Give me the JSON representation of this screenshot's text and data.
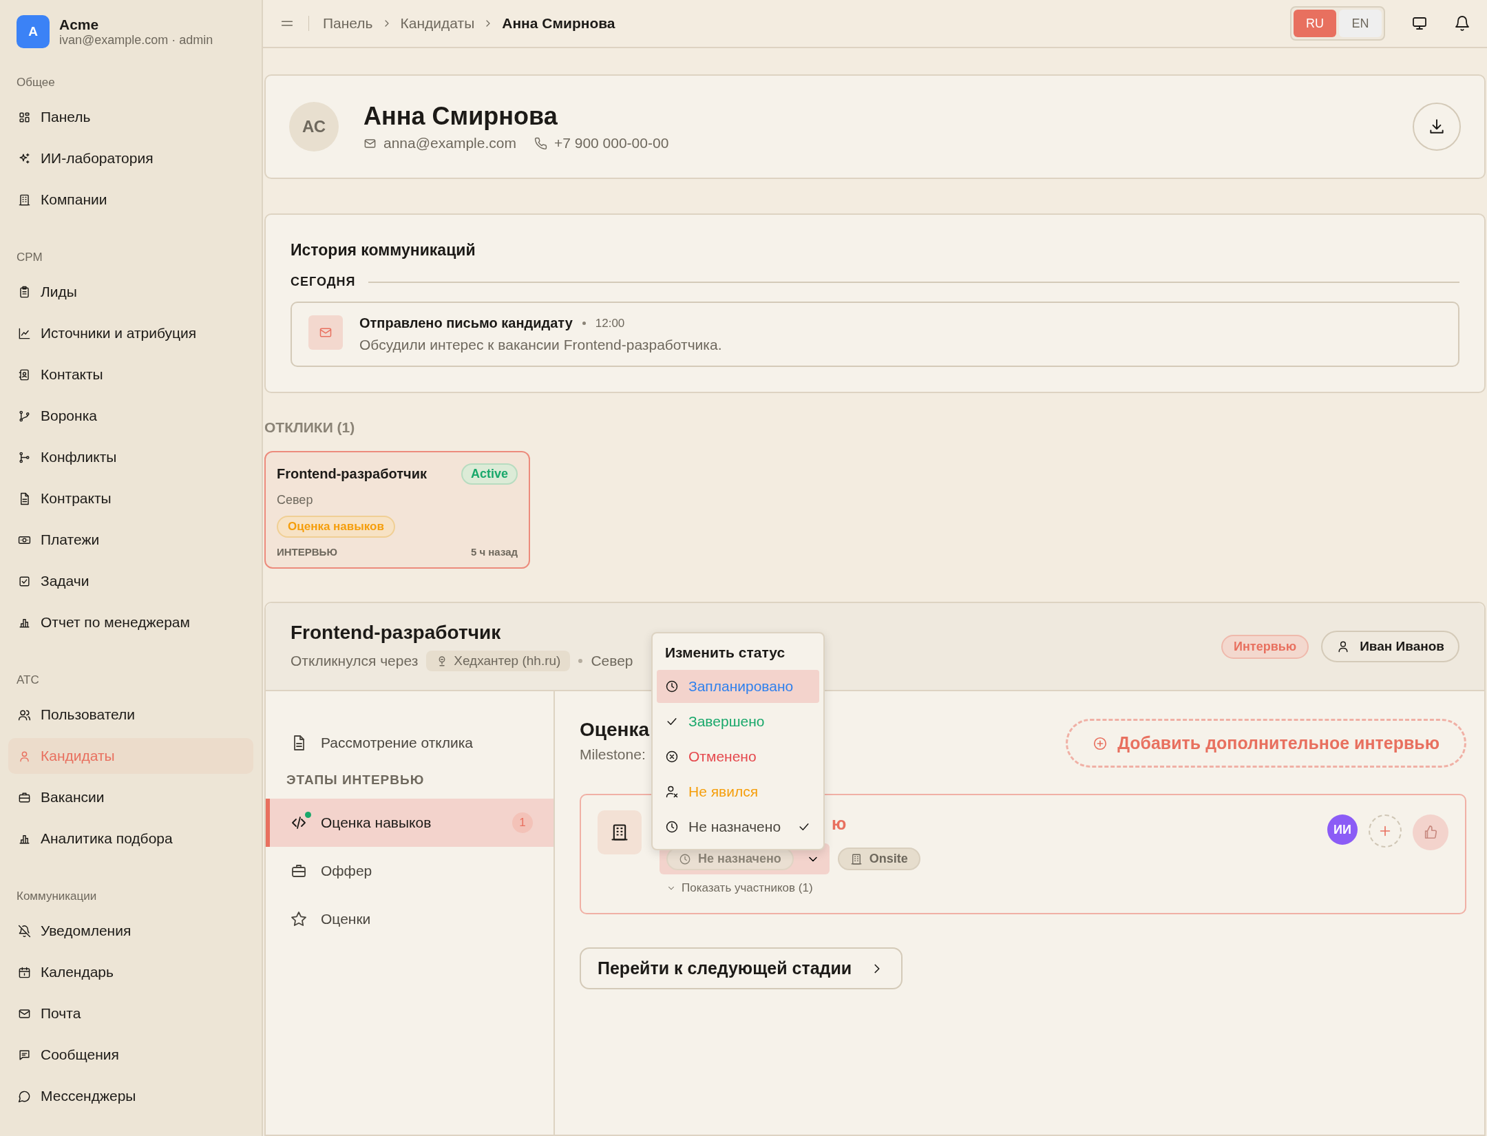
{
  "brand": {
    "initial": "A",
    "name": "Acme",
    "subtitle": "ivan@example.com · admin"
  },
  "sidebar": {
    "sections": [
      {
        "title": "Общее",
        "items": [
          {
            "label": "Панель",
            "selected": false
          },
          {
            "label": "ИИ-лаборатория",
            "selected": false
          },
          {
            "label": "Компании",
            "selected": false
          }
        ]
      },
      {
        "title": "CPM",
        "items": [
          {
            "label": "Лиды",
            "selected": false
          },
          {
            "label": "Источники и атрибуция",
            "selected": false
          },
          {
            "label": "Контакты",
            "selected": false
          },
          {
            "label": "Воронка",
            "selected": false
          },
          {
            "label": "Конфликты",
            "selected": false
          },
          {
            "label": "Контракты",
            "selected": false
          },
          {
            "label": "Платежи",
            "selected": false
          },
          {
            "label": "Задачи",
            "selected": false
          },
          {
            "label": "Отчет по менеджерам",
            "selected": false
          }
        ]
      },
      {
        "title": "ATC",
        "items": [
          {
            "label": "Пользователи",
            "selected": false
          },
          {
            "label": "Кандидаты",
            "selected": true
          },
          {
            "label": "Вакансии",
            "selected": false
          },
          {
            "label": "Аналитика подбора",
            "selected": false
          }
        ]
      },
      {
        "title": "Коммуникации",
        "items": [
          {
            "label": "Уведомления",
            "selected": false
          },
          {
            "label": "Календарь",
            "selected": false
          },
          {
            "label": "Почта",
            "selected": false
          },
          {
            "label": "Сообщения",
            "selected": false
          },
          {
            "label": "Мессенджеры",
            "selected": false
          }
        ]
      }
    ]
  },
  "topbar": {
    "breadcrumbs": [
      "Панель",
      "Кандидаты",
      "Анна Смирнова"
    ],
    "languages": [
      {
        "label": "RU",
        "selected": true
      },
      {
        "label": "EN",
        "selected": false
      }
    ]
  },
  "candidate": {
    "initials": "АС",
    "name": "Анна Смирнова",
    "email": "anna@example.com",
    "phone": "+7 900 000-00-00"
  },
  "history": {
    "title": "История коммуникаций",
    "groups": [
      {
        "label": "СЕГОДНЯ",
        "events": [
          {
            "title": "Отправлено письмо кандидату",
            "time": "12:00",
            "text": "Обсудили интерес к вакансии Frontend-разработчика."
          }
        ]
      }
    ]
  },
  "applications": {
    "title": "ОТКЛИКИ (1)",
    "items": [
      {
        "title": "Frontend-разработчик",
        "status": "Active",
        "location": "Север",
        "stage": "Оценка навыков",
        "type": "ИНТЕРВЬЮ",
        "age": "5 ч назад",
        "selected": true
      }
    ]
  },
  "detail": {
    "title": "Frontend-разработчик",
    "source_prefix": "Откликнулся через",
    "source": "Хедхантер (hh.ru)",
    "location": "Север",
    "stage_badge": "Интервью",
    "owner": "Иван Иванов",
    "stages": [
      {
        "kind": "step",
        "label": "Рассмотрение отклика",
        "selected": false
      },
      {
        "kind": "heading",
        "label": "ЭТАПЫ ИНТЕРВЬЮ"
      },
      {
        "kind": "step",
        "label": "Оценка навыков",
        "selected": true,
        "count": "1",
        "has_dot": true
      },
      {
        "kind": "step",
        "label": "Оффер",
        "selected": false
      },
      {
        "kind": "step",
        "label": "Оценки",
        "selected": false
      }
    ],
    "content": {
      "heading": "Оценка",
      "milestone": "Milestone:",
      "add_button": "Добавить дополнительное интервью",
      "interview": {
        "title": "ю",
        "status": "Не назначено",
        "format": "Onsite",
        "participants": "Показать участников (1)",
        "avatar": "ИИ"
      },
      "next_button": "Перейти к следующей стадии"
    },
    "status_menu": {
      "title": "Изменить статус",
      "items": [
        {
          "kind": "scheduled",
          "label": "Запланировано",
          "color": "#2f80ed",
          "highlighted": true,
          "selected": false
        },
        {
          "kind": "done",
          "label": "Завершено",
          "color": "#19a86b",
          "highlighted": false,
          "selected": false
        },
        {
          "kind": "cancelled",
          "label": "Отменено",
          "color": "#e5484d",
          "highlighted": false,
          "selected": false
        },
        {
          "kind": "no_show",
          "label": "Не явился",
          "color": "#f59e0b",
          "highlighted": false,
          "selected": false
        },
        {
          "kind": "unassigned",
          "label": "Не назначено",
          "color": "#4a463f",
          "highlighted": false,
          "selected": true
        }
      ]
    }
  }
}
